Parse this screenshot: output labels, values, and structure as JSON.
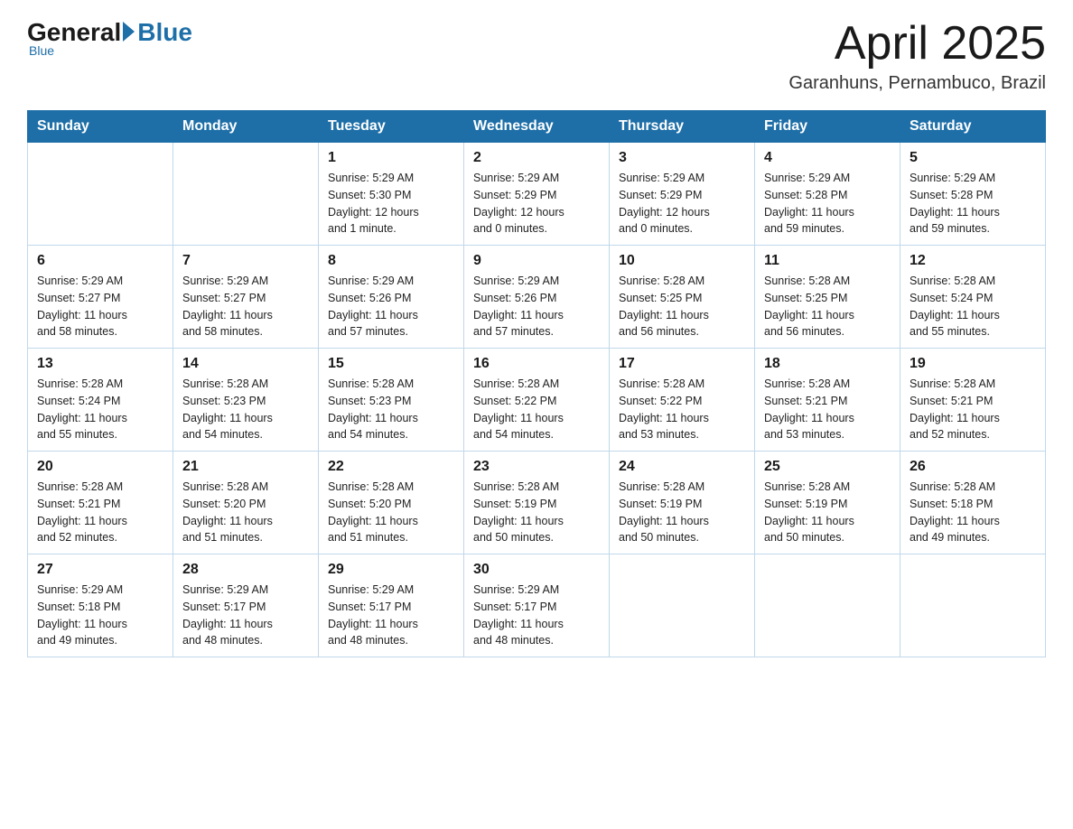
{
  "header": {
    "logo_general": "General",
    "logo_blue": "Blue",
    "logo_subline": "Blue",
    "month": "April 2025",
    "location": "Garanhuns, Pernambuco, Brazil"
  },
  "columns": [
    "Sunday",
    "Monday",
    "Tuesday",
    "Wednesday",
    "Thursday",
    "Friday",
    "Saturday"
  ],
  "weeks": [
    [
      {
        "day": "",
        "info": ""
      },
      {
        "day": "",
        "info": ""
      },
      {
        "day": "1",
        "info": "Sunrise: 5:29 AM\nSunset: 5:30 PM\nDaylight: 12 hours\nand 1 minute."
      },
      {
        "day": "2",
        "info": "Sunrise: 5:29 AM\nSunset: 5:29 PM\nDaylight: 12 hours\nand 0 minutes."
      },
      {
        "day": "3",
        "info": "Sunrise: 5:29 AM\nSunset: 5:29 PM\nDaylight: 12 hours\nand 0 minutes."
      },
      {
        "day": "4",
        "info": "Sunrise: 5:29 AM\nSunset: 5:28 PM\nDaylight: 11 hours\nand 59 minutes."
      },
      {
        "day": "5",
        "info": "Sunrise: 5:29 AM\nSunset: 5:28 PM\nDaylight: 11 hours\nand 59 minutes."
      }
    ],
    [
      {
        "day": "6",
        "info": "Sunrise: 5:29 AM\nSunset: 5:27 PM\nDaylight: 11 hours\nand 58 minutes."
      },
      {
        "day": "7",
        "info": "Sunrise: 5:29 AM\nSunset: 5:27 PM\nDaylight: 11 hours\nand 58 minutes."
      },
      {
        "day": "8",
        "info": "Sunrise: 5:29 AM\nSunset: 5:26 PM\nDaylight: 11 hours\nand 57 minutes."
      },
      {
        "day": "9",
        "info": "Sunrise: 5:29 AM\nSunset: 5:26 PM\nDaylight: 11 hours\nand 57 minutes."
      },
      {
        "day": "10",
        "info": "Sunrise: 5:28 AM\nSunset: 5:25 PM\nDaylight: 11 hours\nand 56 minutes."
      },
      {
        "day": "11",
        "info": "Sunrise: 5:28 AM\nSunset: 5:25 PM\nDaylight: 11 hours\nand 56 minutes."
      },
      {
        "day": "12",
        "info": "Sunrise: 5:28 AM\nSunset: 5:24 PM\nDaylight: 11 hours\nand 55 minutes."
      }
    ],
    [
      {
        "day": "13",
        "info": "Sunrise: 5:28 AM\nSunset: 5:24 PM\nDaylight: 11 hours\nand 55 minutes."
      },
      {
        "day": "14",
        "info": "Sunrise: 5:28 AM\nSunset: 5:23 PM\nDaylight: 11 hours\nand 54 minutes."
      },
      {
        "day": "15",
        "info": "Sunrise: 5:28 AM\nSunset: 5:23 PM\nDaylight: 11 hours\nand 54 minutes."
      },
      {
        "day": "16",
        "info": "Sunrise: 5:28 AM\nSunset: 5:22 PM\nDaylight: 11 hours\nand 54 minutes."
      },
      {
        "day": "17",
        "info": "Sunrise: 5:28 AM\nSunset: 5:22 PM\nDaylight: 11 hours\nand 53 minutes."
      },
      {
        "day": "18",
        "info": "Sunrise: 5:28 AM\nSunset: 5:21 PM\nDaylight: 11 hours\nand 53 minutes."
      },
      {
        "day": "19",
        "info": "Sunrise: 5:28 AM\nSunset: 5:21 PM\nDaylight: 11 hours\nand 52 minutes."
      }
    ],
    [
      {
        "day": "20",
        "info": "Sunrise: 5:28 AM\nSunset: 5:21 PM\nDaylight: 11 hours\nand 52 minutes."
      },
      {
        "day": "21",
        "info": "Sunrise: 5:28 AM\nSunset: 5:20 PM\nDaylight: 11 hours\nand 51 minutes."
      },
      {
        "day": "22",
        "info": "Sunrise: 5:28 AM\nSunset: 5:20 PM\nDaylight: 11 hours\nand 51 minutes."
      },
      {
        "day": "23",
        "info": "Sunrise: 5:28 AM\nSunset: 5:19 PM\nDaylight: 11 hours\nand 50 minutes."
      },
      {
        "day": "24",
        "info": "Sunrise: 5:28 AM\nSunset: 5:19 PM\nDaylight: 11 hours\nand 50 minutes."
      },
      {
        "day": "25",
        "info": "Sunrise: 5:28 AM\nSunset: 5:19 PM\nDaylight: 11 hours\nand 50 minutes."
      },
      {
        "day": "26",
        "info": "Sunrise: 5:28 AM\nSunset: 5:18 PM\nDaylight: 11 hours\nand 49 minutes."
      }
    ],
    [
      {
        "day": "27",
        "info": "Sunrise: 5:29 AM\nSunset: 5:18 PM\nDaylight: 11 hours\nand 49 minutes."
      },
      {
        "day": "28",
        "info": "Sunrise: 5:29 AM\nSunset: 5:17 PM\nDaylight: 11 hours\nand 48 minutes."
      },
      {
        "day": "29",
        "info": "Sunrise: 5:29 AM\nSunset: 5:17 PM\nDaylight: 11 hours\nand 48 minutes."
      },
      {
        "day": "30",
        "info": "Sunrise: 5:29 AM\nSunset: 5:17 PM\nDaylight: 11 hours\nand 48 minutes."
      },
      {
        "day": "",
        "info": ""
      },
      {
        "day": "",
        "info": ""
      },
      {
        "day": "",
        "info": ""
      }
    ]
  ]
}
